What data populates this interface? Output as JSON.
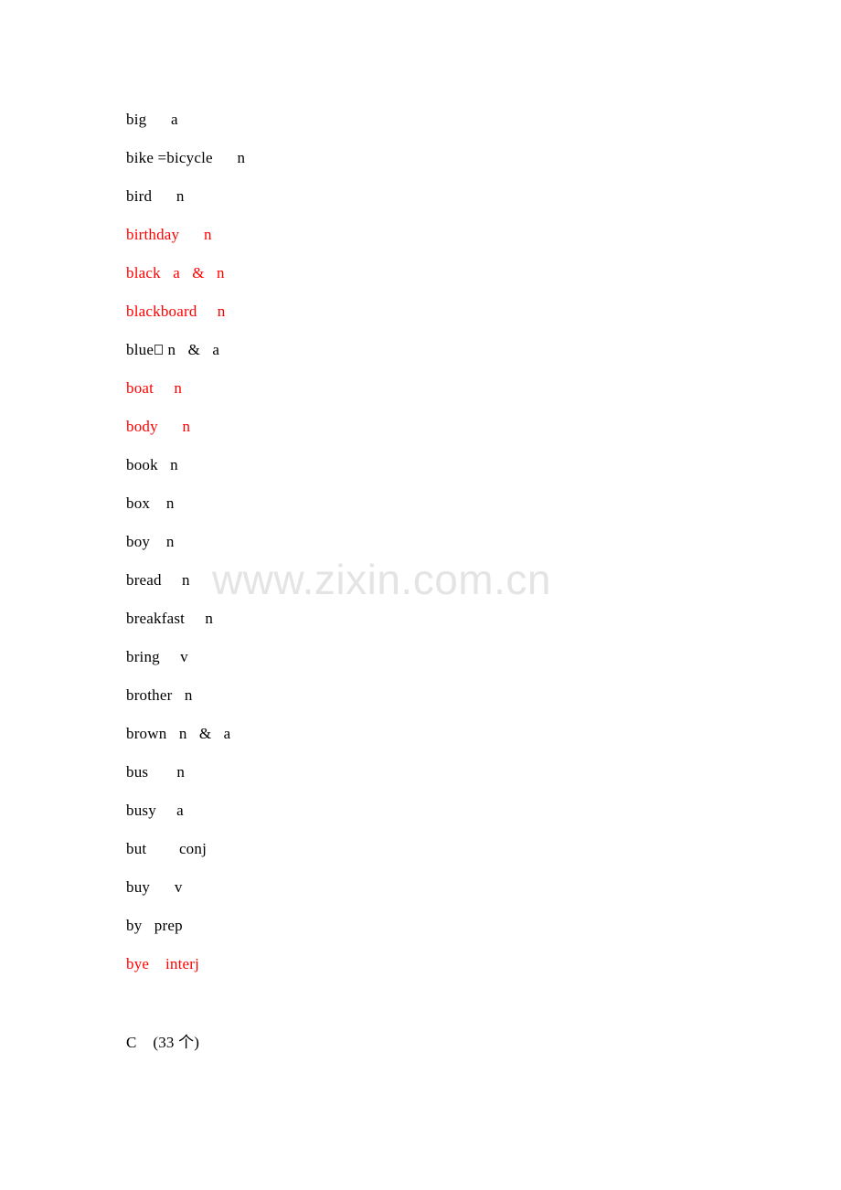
{
  "page": {
    "background_color": "#ffffff",
    "text_color": "#000000",
    "highlight_color": "#ff0000",
    "watermark_color": "#e4e4e4"
  },
  "watermark": {
    "text": "www.zixin.com.cn"
  },
  "entries": [
    {
      "word": "big",
      "spacer": "      ",
      "pos": "a",
      "red": false
    },
    {
      "word": "bike =bicycle",
      "spacer": "      ",
      "pos": "n",
      "red": false
    },
    {
      "word": "bird",
      "spacer": "      ",
      "pos": "n",
      "red": false
    },
    {
      "word": "birthday",
      "spacer": "      ",
      "pos": "n",
      "red": true
    },
    {
      "word": "black",
      "spacer": "   ",
      "pos": "a   &   n",
      "red": true
    },
    {
      "word": "blackboard",
      "spacer": "     ",
      "pos": "n",
      "red": true
    },
    {
      "word": "blue",
      "spacer": " ",
      "pos": "n   &   a",
      "red": false,
      "tofu_after_word": true
    },
    {
      "word": "boat",
      "spacer": "     ",
      "pos": "n",
      "red": true
    },
    {
      "word": "body",
      "spacer": "      ",
      "pos": "n",
      "red": true
    },
    {
      "word": "book",
      "spacer": "   ",
      "pos": "n",
      "red": false
    },
    {
      "word": "box",
      "spacer": "    ",
      "pos": "n",
      "red": false
    },
    {
      "word": "boy",
      "spacer": "    ",
      "pos": "n",
      "red": false
    },
    {
      "word": "bread",
      "spacer": "     ",
      "pos": "n",
      "red": false
    },
    {
      "word": "breakfast",
      "spacer": "     ",
      "pos": "n",
      "red": false
    },
    {
      "word": "bring",
      "spacer": "     ",
      "pos": "v",
      "red": false
    },
    {
      "word": "brother",
      "spacer": "   ",
      "pos": "n",
      "red": false
    },
    {
      "word": "brown",
      "spacer": "   ",
      "pos": "n   &   a",
      "red": false
    },
    {
      "word": "bus",
      "spacer": "       ",
      "pos": "n",
      "red": false
    },
    {
      "word": "busy",
      "spacer": "     ",
      "pos": "a",
      "red": false
    },
    {
      "word": "but",
      "spacer": "        ",
      "pos": "conj",
      "red": false
    },
    {
      "word": "buy",
      "spacer": "      ",
      "pos": "v",
      "red": false
    },
    {
      "word": "by",
      "spacer": "   ",
      "pos": "prep",
      "red": false
    },
    {
      "word": "bye",
      "spacer": "    ",
      "pos": "interj",
      "red": true
    }
  ],
  "section": {
    "letter": "C",
    "spacer": "    ",
    "count_label": "(33 个)"
  }
}
